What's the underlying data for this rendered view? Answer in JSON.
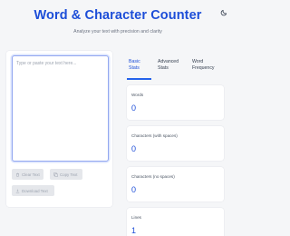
{
  "header": {
    "title": "Word & Character Counter",
    "subtitle": "Analyze your text with precision and clarity",
    "theme_icon": "moon-icon"
  },
  "editor": {
    "placeholder": "Type or paste your text here...",
    "value": ""
  },
  "actions": {
    "clear_label": "Clear Text",
    "copy_label": "Copy Text",
    "download_label": "Download Text"
  },
  "tabs": [
    {
      "label": "Basic Stats",
      "line1": "Basic",
      "line2": "Stats",
      "active": true
    },
    {
      "label": "Advanced Stats",
      "line1": "Advanced",
      "line2": "Stats",
      "active": false
    },
    {
      "label": "Word Frequency",
      "line1": "Word",
      "line2": "Frequency",
      "active": false
    }
  ],
  "stats": [
    {
      "label": "Words",
      "value": "0"
    },
    {
      "label": "Characters (with spaces)",
      "value": "0"
    },
    {
      "label": "Characters (no spaces)",
      "value": "0"
    },
    {
      "label": "Lines",
      "value": "1"
    }
  ],
  "colors": {
    "accent": "#1d4ed8",
    "background": "#f5f6f8",
    "button_disabled": "#e5e7eb"
  }
}
